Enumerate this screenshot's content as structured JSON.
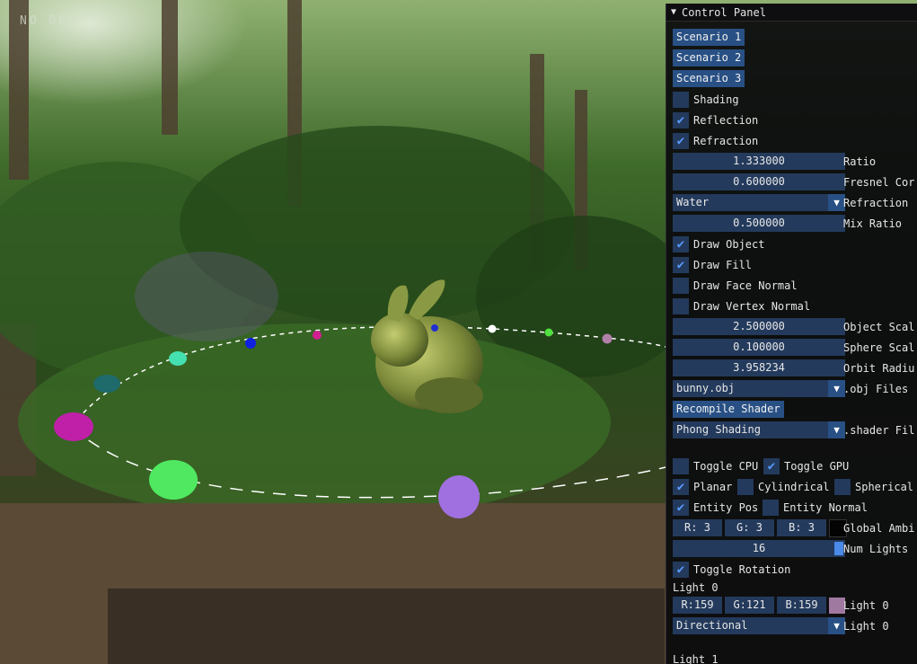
{
  "overlay": {
    "logo": "NO DE"
  },
  "panel": {
    "title": "Control Panel",
    "scenario_buttons": [
      "Scenario 1",
      "Scenario 2",
      "Scenario 3"
    ],
    "shading": {
      "label": "Shading",
      "checked": false
    },
    "reflection": {
      "label": "Reflection",
      "checked": true
    },
    "refraction": {
      "label": "Refraction",
      "checked": true
    },
    "ratio": {
      "value": "1.333000",
      "label": "Ratio"
    },
    "fresnel": {
      "value": "0.600000",
      "label": "Fresnel Cor"
    },
    "refraction_material": {
      "value": "Water",
      "label": "Refraction"
    },
    "mix_ratio": {
      "value": "0.500000",
      "label": "Mix Ratio"
    },
    "draw_object": {
      "label": "Draw Object",
      "checked": true
    },
    "draw_fill": {
      "label": "Draw Fill",
      "checked": true
    },
    "draw_face_normal": {
      "label": "Draw Face Normal",
      "checked": false
    },
    "draw_vertex_normal": {
      "label": "Draw Vertex Normal",
      "checked": false
    },
    "object_scale": {
      "value": "2.500000",
      "label": "Object Scal"
    },
    "sphere_scale": {
      "value": "0.100000",
      "label": "Sphere Scal"
    },
    "orbit_radius": {
      "value": "3.958234",
      "label": "Orbit Radiu"
    },
    "obj_file": {
      "value": "bunny.obj",
      "label": ".obj Files"
    },
    "recompile": "Recompile Shader",
    "shader_file": {
      "value": "Phong Shading",
      "label": ".shader Fil"
    },
    "toggle_cpu": {
      "label": "Toggle CPU",
      "checked": false
    },
    "toggle_gpu": {
      "label": "Toggle GPU",
      "checked": true
    },
    "planar": {
      "label": "Planar",
      "checked": true
    },
    "cylindrical": {
      "label": "Cylindrical",
      "checked": false
    },
    "spherical": {
      "label": "Spherical",
      "checked": false
    },
    "entity_pos": {
      "label": "Entity Pos",
      "checked": true
    },
    "entity_normal": {
      "label": "Entity Normal",
      "checked": false
    },
    "global_ambient": {
      "r": "R:  3",
      "g": "G:  3",
      "b": "B:  3",
      "label": "Global Ambi",
      "color": "#030303"
    },
    "num_lights": {
      "value": "16",
      "label": "Num Lights",
      "fraction": 1.0
    },
    "toggle_rotation": {
      "label": "Toggle Rotation",
      "checked": true
    },
    "light0_header": "Light 0",
    "light0_color": {
      "r": "R:159",
      "g": "G:121",
      "b": "B:159",
      "label": "Light 0",
      "color": "#9f799f"
    },
    "light0_type": {
      "value": "Directional",
      "label": "Light 0"
    },
    "light1_header": "Light 1",
    "checkmark": "✔",
    "dropdown_arrow": "▼",
    "collapse_arrow": "▼"
  },
  "accent_colors": {
    "panel_bg": "#0c0c0e",
    "button": "#285084",
    "frame": "#233a5c",
    "check": "#5a9bff"
  }
}
